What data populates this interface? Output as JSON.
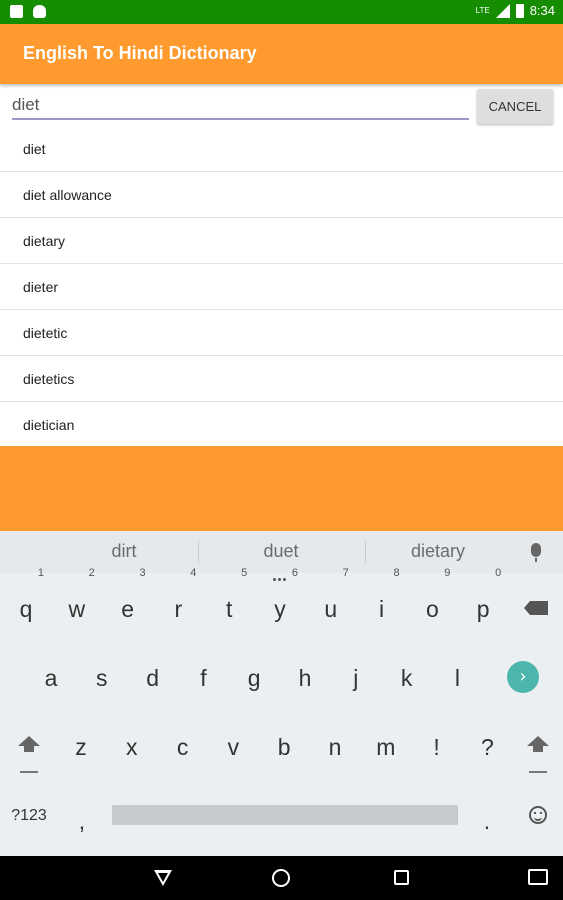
{
  "status_bar": {
    "time": "8:34",
    "network": "LTE"
  },
  "app_bar": {
    "title": "English To Hindi Dictionary"
  },
  "search": {
    "value": "diet",
    "cancel_label": "CANCEL"
  },
  "results": [
    "diet",
    "diet allowance",
    "dietary",
    "dieter",
    "dietetic",
    "dietetics",
    "dietician"
  ],
  "keyboard": {
    "suggestions": [
      "dirt",
      "duet",
      "dietary"
    ],
    "row1": [
      {
        "key": "q",
        "num": "1"
      },
      {
        "key": "w",
        "num": "2"
      },
      {
        "key": "e",
        "num": "3"
      },
      {
        "key": "r",
        "num": "4"
      },
      {
        "key": "t",
        "num": "5"
      },
      {
        "key": "y",
        "num": "6"
      },
      {
        "key": "u",
        "num": "7"
      },
      {
        "key": "i",
        "num": "8"
      },
      {
        "key": "o",
        "num": "9"
      },
      {
        "key": "p",
        "num": "0"
      }
    ],
    "row2": [
      "a",
      "s",
      "d",
      "f",
      "g",
      "h",
      "j",
      "k",
      "l"
    ],
    "row3": [
      "z",
      "x",
      "c",
      "v",
      "b",
      "n",
      "m",
      "!",
      "?"
    ],
    "symbols_label": "?123",
    "comma": ",",
    "period": "."
  },
  "colors": {
    "status_bar": "#168c00",
    "app_bar": "#ff9a2e",
    "enter_key": "#4db6ac"
  }
}
